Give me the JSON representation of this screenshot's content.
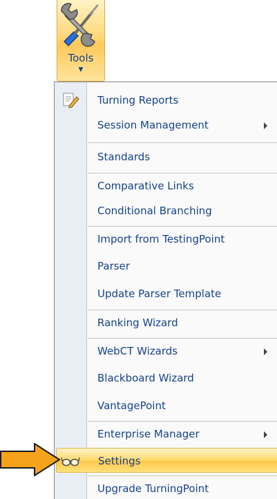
{
  "ribbon": {
    "tools_label": "Tools",
    "tools_icon": "tools-wrench-screwdriver-icon"
  },
  "menu": {
    "items": [
      {
        "label": "Turning Reports",
        "icon": "report-icon"
      },
      {
        "label": "Session Management",
        "submenu": true
      },
      {
        "label": "Standards"
      },
      {
        "label": "Comparative Links"
      },
      {
        "label": "Conditional Branching"
      },
      {
        "label": "Import from TestingPoint"
      },
      {
        "label": "Parser"
      },
      {
        "label": "Update Parser Template"
      },
      {
        "label": "Ranking Wizard"
      },
      {
        "label": "WebCT Wizards",
        "submenu": true
      },
      {
        "label": "Blackboard Wizard"
      },
      {
        "label": "VantagePoint"
      },
      {
        "label": "Enterprise Manager",
        "submenu": true
      },
      {
        "label": "Settings",
        "icon": "glasses-icon",
        "highlighted": true
      },
      {
        "label": "Upgrade TurningPoint"
      }
    ]
  },
  "annotation": {
    "arrow_color": "#f5a31a",
    "arrow_target": "Settings"
  },
  "colors": {
    "menu_text": "#15428b",
    "highlight": "#ffd96b",
    "gutter": "#e9eef5"
  }
}
